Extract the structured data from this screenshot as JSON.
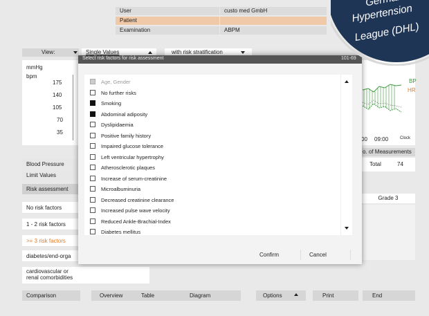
{
  "header_info": {
    "user_label": "User",
    "user_value": "custo med GmbH",
    "patient_label": "Patient",
    "patient_value": "",
    "exam_label": "Examination",
    "exam_value": "ABPM"
  },
  "view_bar": {
    "view_label": "View:",
    "values_select": "Single Values",
    "stratification_select": "with risk stratification"
  },
  "chart": {
    "unit_mmhg": "mmHg",
    "unit_bpm": "bpm",
    "y_ticks": [
      "175",
      "140",
      "105",
      "70",
      "35"
    ],
    "legend_bp": "BP",
    "legend_hr": "HR",
    "x_tick_1": "00",
    "x_tick_2": "09:00",
    "x_unit": "Clock"
  },
  "measurements": {
    "header": "o. of Measurements",
    "total_label": "Total",
    "total_value": "74"
  },
  "left_menu": {
    "blood_pressure": "Blood Pressure",
    "limit_values": "Limit Values",
    "risk_assessment": "Risk assessment"
  },
  "risk_table": {
    "rows": [
      "No risk factors",
      "1 - 2 risk factors",
      ">= 3 risk factors",
      "diabetes/end-orga",
      "cardiovascular or\nrenal comorbidities"
    ],
    "grade3": "Grade 3"
  },
  "modal": {
    "title": "Select risk factors for risk assessment",
    "id_text": "101-69",
    "confirm": "Confirm",
    "cancel": "Cancel",
    "items": [
      {
        "label": "Age, Gender",
        "state": "disabled"
      },
      {
        "label": "No further risks",
        "state": "unchecked"
      },
      {
        "label": "Smoking",
        "state": "checked"
      },
      {
        "label": "Abdominal adiposity",
        "state": "checked"
      },
      {
        "label": "Dyslipidaemia",
        "state": "unchecked"
      },
      {
        "label": "Positive family history",
        "state": "unchecked"
      },
      {
        "label": "Impaired glucose tolerance",
        "state": "unchecked"
      },
      {
        "label": "Left ventricular hypertrophy",
        "state": "unchecked"
      },
      {
        "label": "Atherosclerotic plaques",
        "state": "unchecked"
      },
      {
        "label": "Increase of serum-creatinine",
        "state": "unchecked"
      },
      {
        "label": "Microalbuminuria",
        "state": "unchecked"
      },
      {
        "label": "Decreased creatinine clearance",
        "state": "unchecked"
      },
      {
        "label": "Increased pulse wave velocity",
        "state": "unchecked"
      },
      {
        "label": "Reduced Ankle-Brachial-Index",
        "state": "unchecked"
      },
      {
        "label": "Diabetes mellitus",
        "state": "unchecked"
      }
    ]
  },
  "bottom_bar": {
    "comparison": "Comparison",
    "overview": "Overview",
    "table": "Table",
    "diagram": "Diagram",
    "options": "Options",
    "print": "Print",
    "end": "End"
  },
  "badge": {
    "line1": "German",
    "line2": "Hypertension",
    "line3": "League (DHL)"
  },
  "colors": {
    "accent_orange": "#e07b2a",
    "patient_row": "#f0c9a8",
    "badge_navy": "#1e3556",
    "hr_line": "#e07b2a",
    "bp_line": "#3a9a3a"
  }
}
